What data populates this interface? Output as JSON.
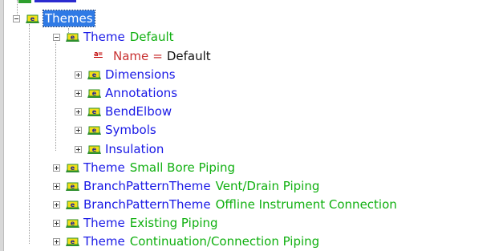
{
  "tree": {
    "themes_node": {
      "label": "Themes"
    },
    "theme_default": {
      "keyword": "Theme",
      "value": "Default",
      "name_attr": {
        "name": "Name",
        "equals": "=",
        "value": "Default"
      },
      "children": [
        "Dimensions",
        "Annotations",
        "BendElbow",
        "Symbols",
        "Insulation"
      ]
    },
    "siblings": [
      {
        "keyword": "Theme",
        "value": "Small Bore Piping"
      },
      {
        "keyword": "BranchPatternTheme",
        "value": "Vent/Drain Piping"
      },
      {
        "keyword": "BranchPatternTheme",
        "value": "Offline Instrument Connection"
      },
      {
        "keyword": "Theme",
        "value": "Existing Piping"
      },
      {
        "keyword": "Theme",
        "value": "Continuation/Connection Piping"
      }
    ]
  },
  "icons": {
    "element": "element-icon",
    "attribute": "attribute-icon"
  },
  "colors": {
    "keyword": "#1a1ae6",
    "value": "#11b011",
    "attribute": "#c83232",
    "selection": "#2f7ae5"
  }
}
